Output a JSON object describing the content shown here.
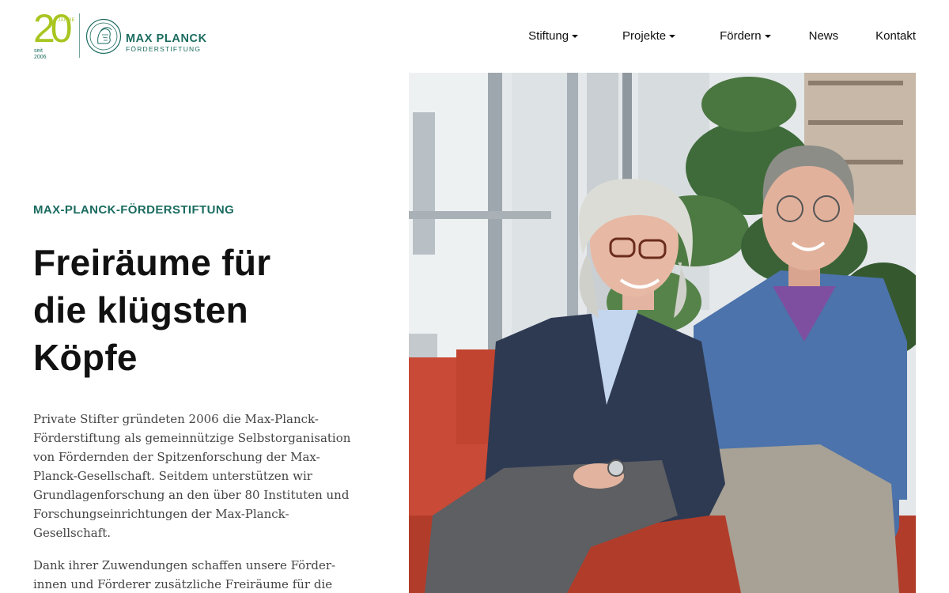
{
  "logo": {
    "anniversary_number": "20",
    "anniversary_label": "JAHRE",
    "since_label": "seit",
    "since_year": "2006",
    "name": "MAX PLANCK",
    "subname": "FÖRDERSTIFTUNG"
  },
  "nav": {
    "items": [
      {
        "label": "Stiftung",
        "has_dropdown": true
      },
      {
        "label": "Projekte",
        "has_dropdown": true
      },
      {
        "label": "Fördern",
        "has_dropdown": true
      },
      {
        "label": "News",
        "has_dropdown": false
      },
      {
        "label": "Kontakt",
        "has_dropdown": false
      }
    ]
  },
  "hero": {
    "eyebrow": "MAX-PLANCK-FÖRDERSTIFTUNG",
    "headline_lines": [
      "Freiräume für",
      "die klügsten",
      "Köpfe"
    ],
    "paragraph1_lines": [
      "Private Stifter gründeten 2006 die Max-Planck-",
      "Förderstiftung als gemeinnützige Selbstorganisation",
      "von Fördernden der Spitzenforschung der Max-",
      "Planck-Gesellschaft. Seitdem unterstützen wir",
      "Grundlagenforschung an den über 80 Instituten und",
      "Forschungseinrichtungen der Max-Planck-",
      "Gesellschaft."
    ],
    "paragraph2_lines": [
      "Dank ihrer Zuwendungen schaffen unsere Förder-",
      "innen und Förderer zusätzliche Freiräume für die"
    ]
  },
  "colors": {
    "brand_green": "#1a6b5f",
    "anniversary_lime": "#a8c520",
    "text": "#111111",
    "body_text": "#444444"
  }
}
